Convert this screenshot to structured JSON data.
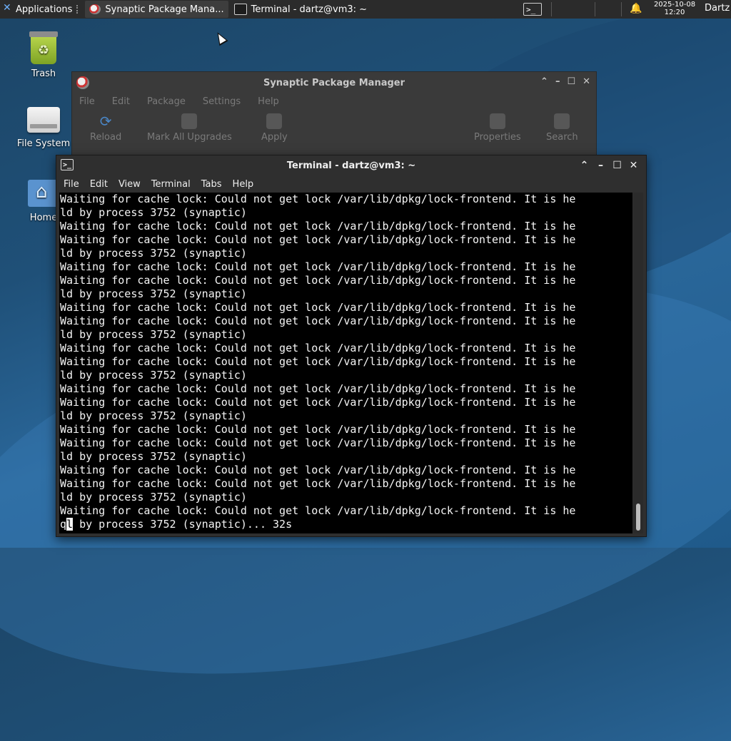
{
  "panel": {
    "applications_label": "Applications",
    "tasks": [
      {
        "label": "Synaptic Package Mana...",
        "active": true
      },
      {
        "label": "Terminal - dartz@vm3: ~",
        "active": false
      }
    ],
    "terminal_glyph": ">_",
    "clock_date": "2025-10-08",
    "clock_time": "12:20",
    "user": "Dartz"
  },
  "desktop": {
    "icons": [
      {
        "label": "Trash",
        "icon": "trash-icon"
      },
      {
        "label": "File System",
        "icon": "drive-icon"
      },
      {
        "label": "Home",
        "icon": "home-folder-icon"
      }
    ]
  },
  "synaptic": {
    "title": "Synaptic Package Manager",
    "menu": [
      "File",
      "Edit",
      "Package",
      "Settings",
      "Help"
    ],
    "toolbar": [
      "Reload",
      "Mark All Upgrades",
      "Apply",
      "Properties",
      "Search"
    ]
  },
  "terminal": {
    "title": "Terminal - dartz@vm3: ~",
    "menu": [
      "File",
      "Edit",
      "View",
      "Terminal",
      "Tabs",
      "Help"
    ],
    "lines": [
      "Waiting for cache lock: Could not get lock /var/lib/dpkg/lock-frontend. It is he",
      "ld by process 3752 (synaptic)",
      "Waiting for cache lock: Could not get lock /var/lib/dpkg/lock-frontend. It is he",
      "Waiting for cache lock: Could not get lock /var/lib/dpkg/lock-frontend. It is he",
      "ld by process 3752 (synaptic)",
      "Waiting for cache lock: Could not get lock /var/lib/dpkg/lock-frontend. It is he",
      "Waiting for cache lock: Could not get lock /var/lib/dpkg/lock-frontend. It is he",
      "ld by process 3752 (synaptic)",
      "Waiting for cache lock: Could not get lock /var/lib/dpkg/lock-frontend. It is he",
      "Waiting for cache lock: Could not get lock /var/lib/dpkg/lock-frontend. It is he",
      "ld by process 3752 (synaptic)",
      "Waiting for cache lock: Could not get lock /var/lib/dpkg/lock-frontend. It is he",
      "Waiting for cache lock: Could not get lock /var/lib/dpkg/lock-frontend. It is he",
      "ld by process 3752 (synaptic)",
      "Waiting for cache lock: Could not get lock /var/lib/dpkg/lock-frontend. It is he",
      "Waiting for cache lock: Could not get lock /var/lib/dpkg/lock-frontend. It is he",
      "ld by process 3752 (synaptic)",
      "Waiting for cache lock: Could not get lock /var/lib/dpkg/lock-frontend. It is he",
      "Waiting for cache lock: Could not get lock /var/lib/dpkg/lock-frontend. It is he",
      "ld by process 3752 (synaptic)",
      "Waiting for cache lock: Could not get lock /var/lib/dpkg/lock-frontend. It is he",
      "Waiting for cache lock: Could not get lock /var/lib/dpkg/lock-frontend. It is he",
      "ld by process 3752 (synaptic)",
      "Waiting for cache lock: Could not get lock /var/lib/dpkg/lock-frontend. It is he"
    ],
    "last_line_cursor_char": "l",
    "last_line_prefix": "q",
    "last_line_rest": " by process 3752 (synaptic)... 32s"
  }
}
